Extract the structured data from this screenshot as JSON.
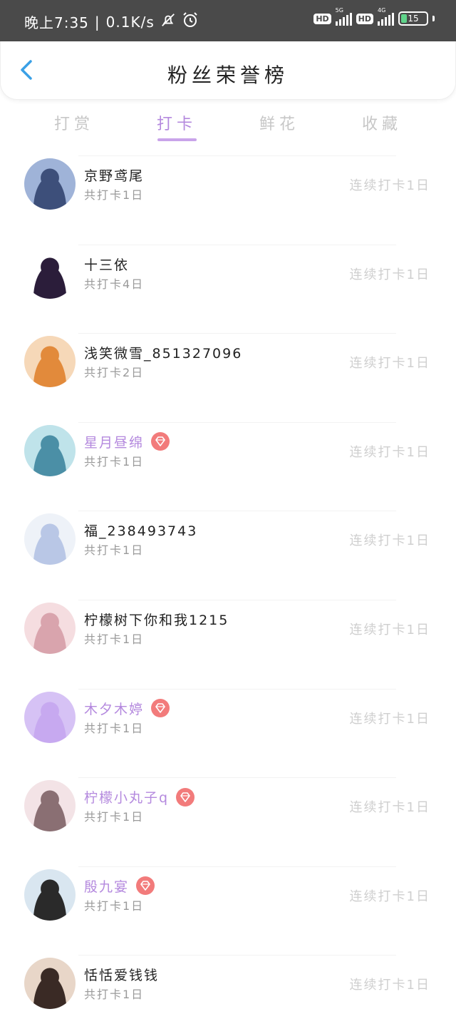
{
  "status_bar": {
    "time": "晚上7:35",
    "speed": "0.1K/s",
    "hd": "HD",
    "net1": "5G",
    "net2": "4G",
    "battery": "15"
  },
  "header": {
    "title": "粉丝荣誉榜"
  },
  "tabs": [
    {
      "label": "打赏",
      "active": false
    },
    {
      "label": "打卡",
      "active": true
    },
    {
      "label": "鲜花",
      "active": false
    },
    {
      "label": "收藏",
      "active": false
    }
  ],
  "fans": [
    {
      "name": "京野鸢尾",
      "total": "共打卡1日",
      "streak": "连续打卡1日",
      "vip": false,
      "avatar": [
        "#9fb3d8",
        "#3d4f7a"
      ]
    },
    {
      "name": "十三依",
      "total": "共打卡4日",
      "streak": "连续打卡1日",
      "vip": false,
      "avatar": [
        "#ffffff",
        "#2b1d3a"
      ]
    },
    {
      "name": "浅笑微雪_851327096",
      "total": "共打卡2日",
      "streak": "连续打卡1日",
      "vip": false,
      "avatar": [
        "#f6d8b8",
        "#e28a3b"
      ]
    },
    {
      "name": "星月昼绵",
      "total": "共打卡1日",
      "streak": "连续打卡1日",
      "vip": true,
      "avatar": [
        "#bfe3ea",
        "#4b8fa6"
      ]
    },
    {
      "name": "福_238493743",
      "total": "共打卡1日",
      "streak": "连续打卡1日",
      "vip": false,
      "avatar": [
        "#eef2f8",
        "#b9c7e6"
      ]
    },
    {
      "name": "柠檬树下你和我1215",
      "total": "共打卡1日",
      "streak": "连续打卡1日",
      "vip": false,
      "avatar": [
        "#f5dde0",
        "#d9a4ad"
      ]
    },
    {
      "name": "木夕木婷",
      "total": "共打卡1日",
      "streak": "连续打卡1日",
      "vip": true,
      "avatar": [
        "#d6c2f5",
        "#c7a9f0"
      ]
    },
    {
      "name": "柠檬小丸子q",
      "total": "共打卡1日",
      "streak": "连续打卡1日",
      "vip": true,
      "avatar": [
        "#f3e3e6",
        "#8a6f73"
      ]
    },
    {
      "name": "殷九宴",
      "total": "共打卡1日",
      "streak": "连续打卡1日",
      "vip": true,
      "avatar": [
        "#d9e6f0",
        "#2a2a2a"
      ]
    },
    {
      "name": "恬恬爱钱钱",
      "total": "共打卡1日",
      "streak": "连续打卡1日",
      "vip": false,
      "avatar": [
        "#e8d6c8",
        "#3a2a25"
      ]
    }
  ],
  "colors": {
    "accent": "#b489de",
    "inactive_tab": "#c7c7c7",
    "streak_text": "#cfcfcf",
    "badge": "#f27b7b",
    "back_arrow": "#3aa0e6"
  }
}
